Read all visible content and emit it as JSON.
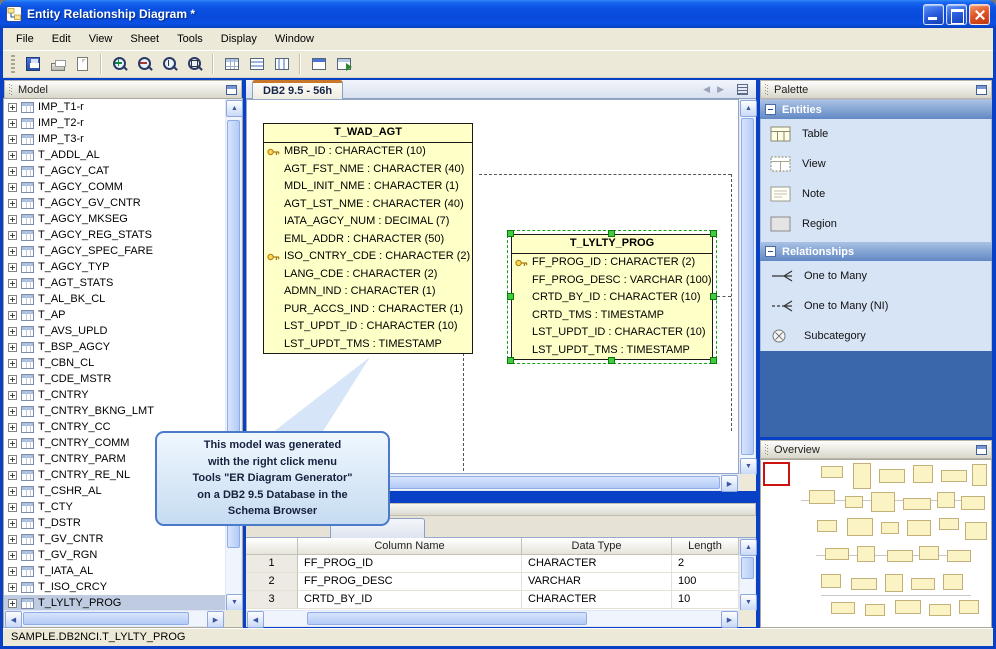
{
  "window": {
    "title": "Entity Relationship Diagram *"
  },
  "menu": {
    "items": [
      "File",
      "Edit",
      "View",
      "Sheet",
      "Tools",
      "Display",
      "Window"
    ]
  },
  "toolbar": {
    "icons": [
      "save",
      "print",
      "print-preview",
      "zoom-in",
      "zoom-out",
      "zoom-original",
      "zoom-fit",
      "grid",
      "tile-rows",
      "tile-columns",
      "new-window",
      "export"
    ]
  },
  "model_panel": {
    "title": "Model",
    "items": [
      {
        "label": "IMP_T1-r"
      },
      {
        "label": "IMP_T2-r"
      },
      {
        "label": "IMP_T3-r"
      },
      {
        "label": "T_ADDL_AL"
      },
      {
        "label": "T_AGCY_CAT"
      },
      {
        "label": "T_AGCY_COMM"
      },
      {
        "label": "T_AGCY_GV_CNTR"
      },
      {
        "label": "T_AGCY_MKSEG"
      },
      {
        "label": "T_AGCY_REG_STATS"
      },
      {
        "label": "T_AGCY_SPEC_FARE"
      },
      {
        "label": "T_AGCY_TYP"
      },
      {
        "label": "T_AGT_STATS"
      },
      {
        "label": "T_AL_BK_CL"
      },
      {
        "label": "T_AP"
      },
      {
        "label": "T_AVS_UPLD"
      },
      {
        "label": "T_BSP_AGCY"
      },
      {
        "label": "T_CBN_CL"
      },
      {
        "label": "T_CDE_MSTR"
      },
      {
        "label": "T_CNTRY"
      },
      {
        "label": "T_CNTRY_BKNG_LMT"
      },
      {
        "label": "T_CNTRY_CC"
      },
      {
        "label": "T_CNTRY_COMM"
      },
      {
        "label": "T_CNTRY_PARM"
      },
      {
        "label": "T_CNTRY_RE_NL"
      },
      {
        "label": "T_CSHR_AL"
      },
      {
        "label": "T_CTY"
      },
      {
        "label": "T_DSTR"
      },
      {
        "label": "T_GV_CNTR"
      },
      {
        "label": "T_GV_RGN"
      },
      {
        "label": "T_IATA_AL"
      },
      {
        "label": "T_ISO_CRCY"
      },
      {
        "label": "T_LYLTY_PROG",
        "selected": true
      }
    ]
  },
  "canvas": {
    "tab": "DB2 9.5 - 56h",
    "entities": [
      {
        "name": "T_WAD_AGT",
        "columns": [
          {
            "pk": true,
            "text": "MBR_ID : CHARACTER (10)"
          },
          {
            "text": "AGT_FST_NME : CHARACTER (40)"
          },
          {
            "text": "MDL_INIT_NME : CHARACTER (1)"
          },
          {
            "text": "AGT_LST_NME : CHARACTER (40)"
          },
          {
            "text": "IATA_AGCY_NUM : DECIMAL (7)"
          },
          {
            "text": "EML_ADDR : CHARACTER (50)"
          },
          {
            "pk": true,
            "text": "ISO_CNTRY_CDE : CHARACTER (2)"
          },
          {
            "text": "LANG_CDE : CHARACTER (2)"
          },
          {
            "text": "ADMN_IND : CHARACTER (1)"
          },
          {
            "text": "PUR_ACCS_IND : CHARACTER (1)"
          },
          {
            "text": "LST_UPDT_ID : CHARACTER (10)"
          },
          {
            "text": "LST_UPDT_TMS : TIMESTAMP"
          }
        ]
      },
      {
        "name": "T_LYLTY_PROG",
        "selected": true,
        "columns": [
          {
            "pk": true,
            "text": "FF_PROG_ID : CHARACTER (2)"
          },
          {
            "text": "FF_PROG_DESC : VARCHAR (100)"
          },
          {
            "text": "CRTD_BY_ID : CHARACTER (10)"
          },
          {
            "text": "CRTD_TMS : TIMESTAMP"
          },
          {
            "text": "LST_UPDT_ID : CHARACTER (10)"
          },
          {
            "text": "LST_UPDT_TMS : TIMESTAMP"
          }
        ]
      }
    ],
    "callout": {
      "text": "This model was generated\nwith the right click menu\nTools \"ER Diagram Generator\"\non a DB2 9.5 Database in the\nSchema Browser"
    }
  },
  "details": {
    "columns": [
      "Column Name",
      "Data Type",
      "Length"
    ],
    "rows": [
      {
        "num": "1",
        "name": "FF_PROG_ID",
        "type": "CHARACTER",
        "len": "2"
      },
      {
        "num": "2",
        "name": "FF_PROG_DESC",
        "type": "VARCHAR",
        "len": "100"
      },
      {
        "num": "3",
        "name": "CRTD_BY_ID",
        "type": "CHARACTER",
        "len": "10"
      }
    ]
  },
  "palette": {
    "title": "Palette",
    "sections": [
      {
        "title": "Entities",
        "items": [
          "Table",
          "View",
          "Note",
          "Region"
        ]
      },
      {
        "title": "Relationships",
        "items": [
          "One to Many",
          "One to Many (NI)",
          "Subcategory"
        ]
      }
    ]
  },
  "overview": {
    "title": "Overview"
  },
  "statusbar": {
    "text": "SAMPLE.DB2NCI.T_LYLTY_PROG"
  },
  "colors": {
    "titlebar_blue": "#0941C6",
    "entity_yellow": "#FFFFC8",
    "selection_green": "#3FCC3F",
    "viewport_red": "#CC1111",
    "palette_blue": "#3A66AC",
    "callout_border_blue": "#4A7AC8"
  }
}
